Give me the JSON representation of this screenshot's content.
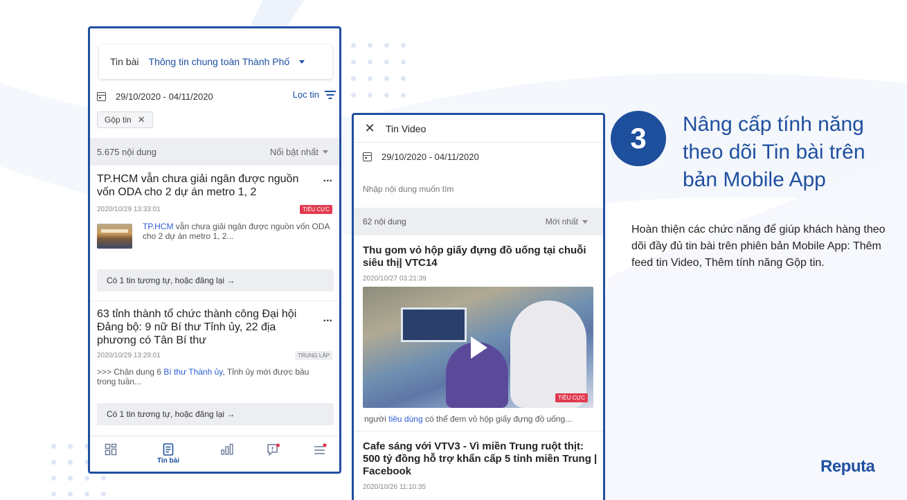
{
  "phone1": {
    "selector_label": "Tin bài",
    "selector_value": "Thông tin chung toàn Thành Phố",
    "date_range": "29/10/2020 - 04/11/2020",
    "filter_label": "Lọc tin",
    "chip_label": "Gộp tin",
    "count": "5.675 nội dung",
    "sort": "Nổi bật nhất",
    "articles": [
      {
        "title": "TP.HCM vẫn chưa giải ngân được nguồn vốn ODA cho 2 dự án metro 1, 2",
        "time": "2020/10/29 13:33:01",
        "sentiment": "TIÊU CỰC",
        "snippet_highlight": "TP.HCM",
        "snippet_rest": " vẫn chưa giải ngân được nguồn vốn ODA cho 2 dự án metro 1, 2...",
        "similar": "Có 1 tin tương tự, hoặc đăng lại →"
      },
      {
        "title": "63 tỉnh thành tổ chức thành công Đại hội Đảng bộ: 9 nữ Bí thư Tỉnh ủy, 22 địa phương có Tân Bí thư",
        "time": "2020/10/29 13:29:01",
        "sentiment": "TRUNG LẬP",
        "snippet_pre": ">>> Chân dung 6 ",
        "snippet_highlight": "Bí thư Thành ủy",
        "snippet_rest": ", Tỉnh ủy mới được bầu trong tuần...",
        "similar": "Có 1 tin tương tự, hoặc đăng lại →"
      }
    ],
    "more_label": "...",
    "tabs": [
      {
        "icon": "dashboard-icon",
        "label": ""
      },
      {
        "icon": "article-icon",
        "label": "Tin bài"
      },
      {
        "icon": "bar-chart-icon",
        "label": ""
      },
      {
        "icon": "alert-message-icon",
        "label": ""
      },
      {
        "icon": "menu-icon",
        "label": ""
      }
    ]
  },
  "phone2": {
    "title": "Tin Video",
    "close": "✕",
    "date_range": "29/10/2020 - 04/11/2020",
    "search_placeholder": "Nhập nội dung muốn tìm",
    "count": "62 nội dung",
    "sort": "Mới nhất",
    "videos": [
      {
        "title": "Thu gom vỏ hộp giấy đựng đồ uống tại chuỗi siêu thị| VTC14",
        "time": "2020/10/27 03:21:39",
        "sentiment": "TIÊU CỰC",
        "snippet_pre": "người ",
        "snippet_highlight": "tiêu dùng",
        "snippet_rest": " có thể đem vỏ hộp giấy đựng đồ uống..."
      },
      {
        "title": "Cafe sáng với VTV3 - Vì miền Trung ruột thịt: 500 tỷ đồng hỗ trợ khẩn cấp 5 tỉnh miền Trung | Facebook",
        "time": "2020/10/26 11:10:35"
      }
    ]
  },
  "feature": {
    "number": "3",
    "headline": "Nâng cấp tính năng theo dõi Tin bài trên bản Mobile App",
    "description": "Hoàn thiện các chức năng để giúp khách hàng theo dõi đầy đủ tin bài trên phiên bản Mobile App: Thêm feed tin Video, Thêm tính năng Gộp tin."
  },
  "brand": {
    "logo": "Reputa",
    "accent": "#1f4f9f",
    "negative": "#e13a4f"
  }
}
